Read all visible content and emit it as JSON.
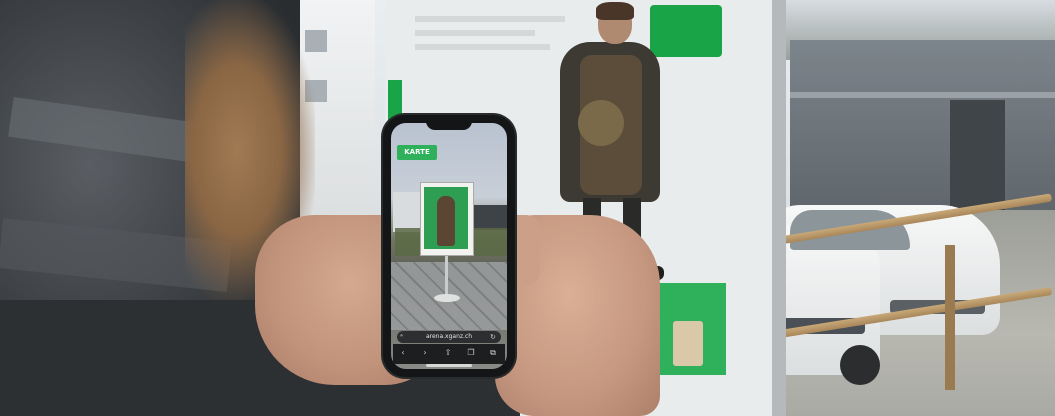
{
  "scene": {
    "description_colors": {
      "poster_green": "#19a447",
      "phone_body": "#141516"
    }
  },
  "phone": {
    "ar_button_label": "KARTE",
    "url_text": "arena.xganz.ch",
    "toolbar_icons": [
      "back-icon",
      "forward-icon",
      "share-icon",
      "bookmarks-icon",
      "tabs-icon"
    ]
  },
  "poster": {
    "tag_text": ""
  }
}
